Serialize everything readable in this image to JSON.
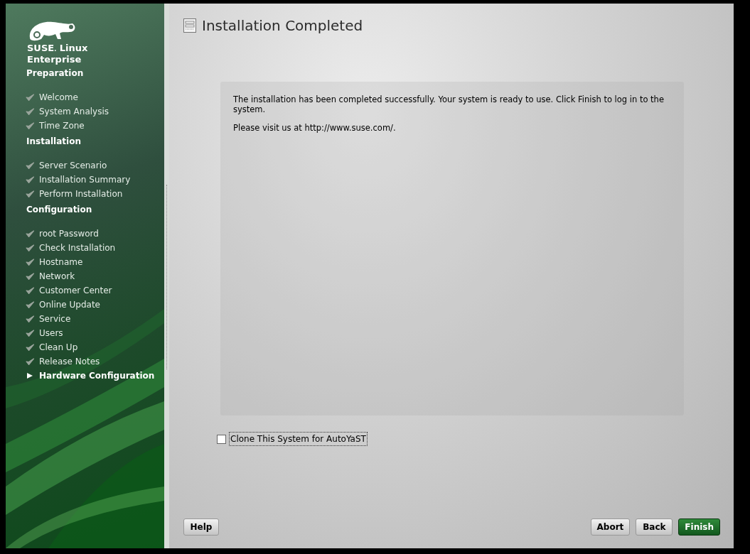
{
  "sidebar": {
    "logo": {
      "brand": "SUSE",
      "mark": ".",
      "product": "Linux",
      "edition": "Enterprise"
    },
    "sections": [
      {
        "title": "Preparation",
        "steps": [
          {
            "label": "Welcome",
            "kind": "done"
          },
          {
            "label": "System Analysis",
            "kind": "done"
          },
          {
            "label": "Time Zone",
            "kind": "done"
          }
        ]
      },
      {
        "title": "Installation",
        "steps": [
          {
            "label": "Server Scenario",
            "kind": "done"
          },
          {
            "label": "Installation Summary",
            "kind": "done"
          },
          {
            "label": "Perform Installation",
            "kind": "done"
          }
        ]
      },
      {
        "title": "Configuration",
        "steps": [
          {
            "label": "root Password",
            "kind": "done"
          },
          {
            "label": "Check Installation",
            "kind": "done"
          },
          {
            "label": "Hostname",
            "kind": "done"
          },
          {
            "label": "Network",
            "kind": "done"
          },
          {
            "label": "Customer Center",
            "kind": "done"
          },
          {
            "label": "Online Update",
            "kind": "done"
          },
          {
            "label": "Service",
            "kind": "done"
          },
          {
            "label": "Users",
            "kind": "done"
          },
          {
            "label": "Clean Up",
            "kind": "done"
          },
          {
            "label": "Release Notes",
            "kind": "done"
          },
          {
            "label": "Hardware Configuration",
            "kind": "current"
          }
        ]
      }
    ]
  },
  "page": {
    "title": "Installation Completed",
    "paragraphs": [
      "The installation has been completed successfully. Your system is ready to use. Click Finish to log in to the system.",
      "Please visit us at http://www.suse.com/."
    ],
    "checkbox": {
      "label": "Clone This System for AutoYaST",
      "checked": false
    }
  },
  "buttons": {
    "help": "Help",
    "right": [
      {
        "label": "Abort",
        "kind": "plain"
      },
      {
        "label": "Back",
        "kind": "plain"
      },
      {
        "label": "Finish",
        "kind": "primary"
      }
    ]
  }
}
